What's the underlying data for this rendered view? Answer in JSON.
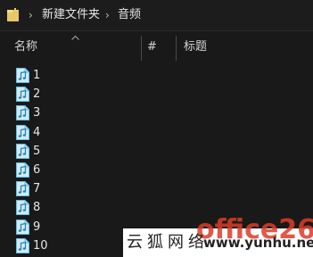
{
  "addressbar": {
    "folder_icon": "folder-icon",
    "separator": "›",
    "crumbs": [
      "新建文件夹",
      "音频"
    ]
  },
  "columns": {
    "name": "名称",
    "number": "#",
    "title": "标题"
  },
  "files": [
    {
      "name": "1",
      "icon": "audio-file-icon"
    },
    {
      "name": "2",
      "icon": "audio-file-icon"
    },
    {
      "name": "3",
      "icon": "audio-file-icon"
    },
    {
      "name": "4",
      "icon": "audio-file-icon"
    },
    {
      "name": "5",
      "icon": "audio-file-icon"
    },
    {
      "name": "6",
      "icon": "audio-file-icon"
    },
    {
      "name": "7",
      "icon": "audio-file-icon"
    },
    {
      "name": "8",
      "icon": "audio-file-icon"
    },
    {
      "name": "9",
      "icon": "audio-file-icon"
    },
    {
      "name": "10",
      "icon": "audio-file-icon"
    }
  ],
  "watermark": {
    "text_cn": "云狐网络",
    "url": "www.yunhu.net",
    "bg_text": "office26"
  },
  "colors": {
    "background": "#191919",
    "text": "#e6e6e6",
    "icon_accent": "#5fc0e6",
    "folder": "#e8c86a"
  }
}
